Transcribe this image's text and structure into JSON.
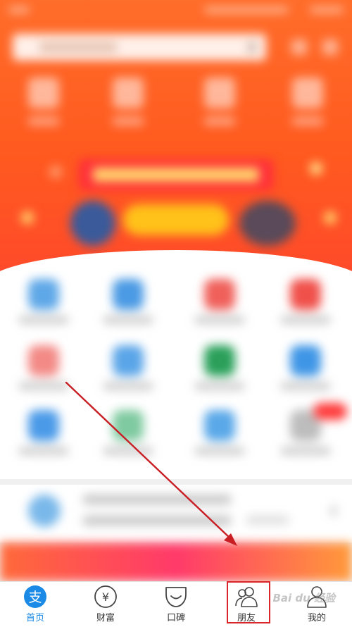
{
  "tabbar": {
    "items": [
      {
        "label": "首页",
        "icon": "alipay-logo-icon"
      },
      {
        "label": "财富",
        "icon": "yen-icon"
      },
      {
        "label": "口碑",
        "icon": "koubei-icon"
      },
      {
        "label": "朋友",
        "icon": "friends-icon"
      },
      {
        "label": "我的",
        "icon": "person-icon"
      }
    ],
    "active_color": "#1a8ae6",
    "home_logo_glyph": "支",
    "yen_glyph": "¥"
  },
  "watermark": "Bai du 经验",
  "colors": {
    "header": "#ff5a1f",
    "highlight": "#d8262b",
    "active": "#1a8ae6"
  }
}
